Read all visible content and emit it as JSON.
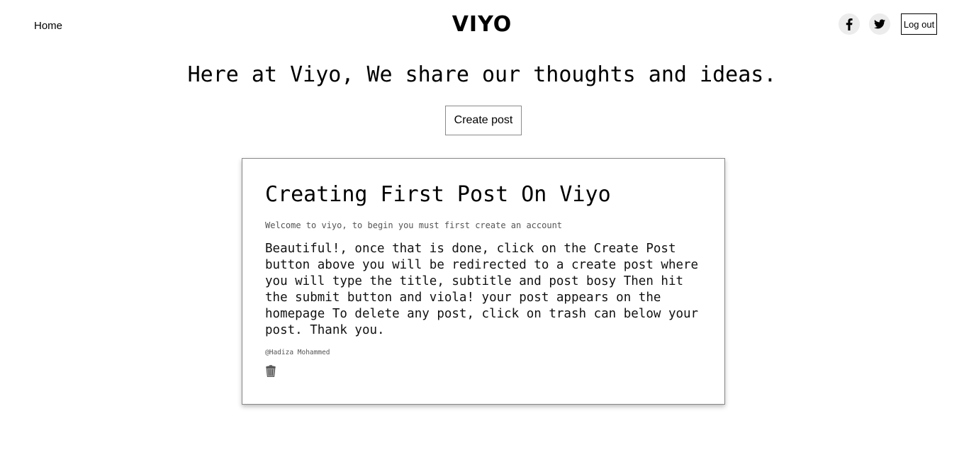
{
  "nav": {
    "home_label": "Home",
    "brand": "VIYO",
    "logout_label": "Log out"
  },
  "icons": {
    "facebook": "facebook-icon",
    "twitter": "twitter-icon",
    "trash": "trash-icon"
  },
  "hero": {
    "tagline": "Here at Viyo, We share our thoughts and ideas.",
    "create_button_label": "Create post"
  },
  "post": {
    "title": "Creating First Post On Viyo",
    "subtitle": "Welcome to viyo, to begin you must first create an account",
    "body": "Beautiful!, once that is done, click on the Create Post button above you will be redirected to a create post where you will type the title, subtitle and post bosy Then hit the submit button and viola! your post appears on the homepage To delete any post, click on trash can below your post. Thank you.",
    "author": "@Hadiza Mohammed"
  }
}
